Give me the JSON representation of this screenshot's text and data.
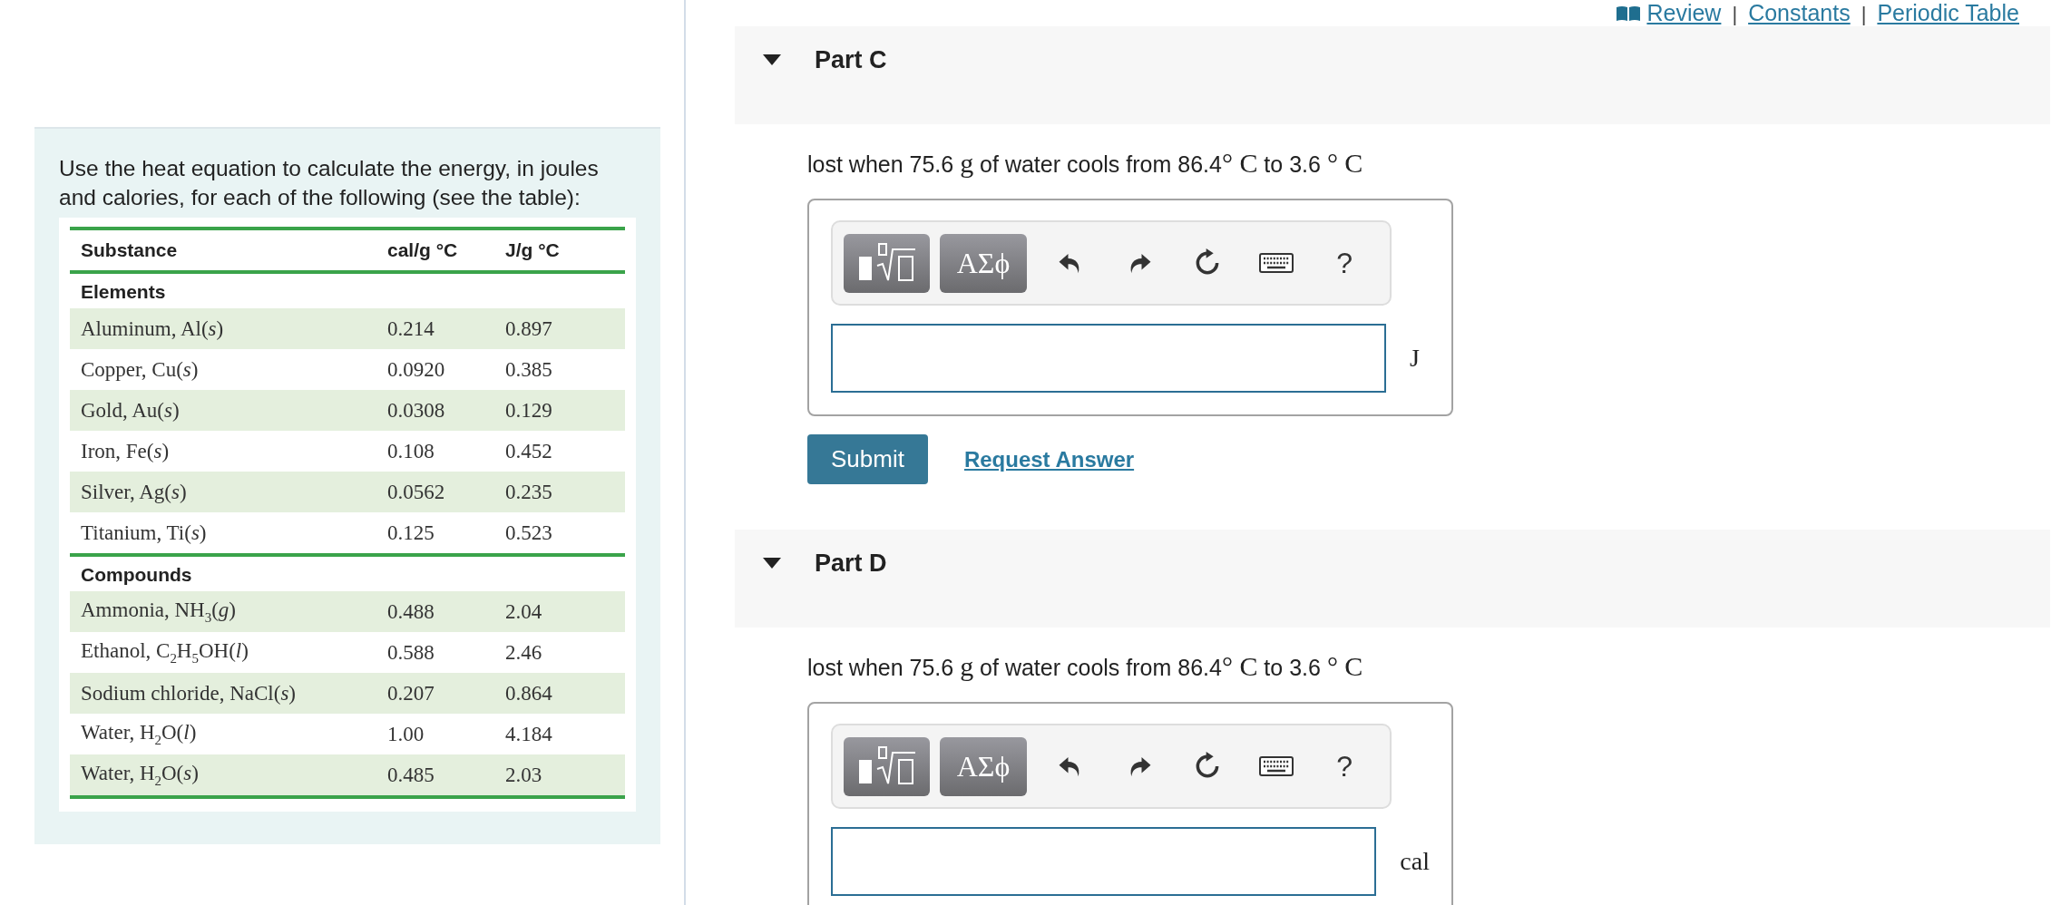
{
  "intro": "Use the heat equation to calculate the energy, in joules and calories, for each of the following (see the table):",
  "table": {
    "columns": [
      "Substance",
      "cal/g °C",
      "J/g °C"
    ],
    "rows": [
      {
        "kind": "section",
        "label": "Elements"
      },
      {
        "kind": "data",
        "cells": [
          "Aluminum, Al(*s*)",
          "0.214",
          "0.897"
        ]
      },
      {
        "kind": "data",
        "cells": [
          "Copper, Cu(*s*)",
          "0.0920",
          "0.385"
        ]
      },
      {
        "kind": "data",
        "cells": [
          "Gold, Au(*s*)",
          "0.0308",
          "0.129"
        ]
      },
      {
        "kind": "data",
        "cells": [
          "Iron, Fe(*s*)",
          "0.108",
          "0.452"
        ]
      },
      {
        "kind": "data",
        "cells": [
          "Silver, Ag(*s*)",
          "0.0562",
          "0.235"
        ]
      },
      {
        "kind": "data",
        "cells": [
          "Titanium, Ti(*s*)",
          "0.125",
          "0.523"
        ]
      },
      {
        "kind": "section",
        "label": "Compounds"
      },
      {
        "kind": "data",
        "cells": [
          "Ammonia, NH$_{3}$(*g*)",
          "0.488",
          "2.04"
        ]
      },
      {
        "kind": "data",
        "cells": [
          "Ethanol, C$_{2}$H$_{5}$OH(*l*)",
          "0.588",
          "2.46"
        ]
      },
      {
        "kind": "data",
        "cells": [
          "Sodium chloride, NaCl(*s*)",
          "0.207",
          "0.864"
        ]
      },
      {
        "kind": "data",
        "cells": [
          "Water, H$_{2}$O(*l*)",
          "1.00",
          "4.184"
        ]
      },
      {
        "kind": "data",
        "cells": [
          "Water, H$_{2}$O(*s*)",
          "0.485",
          "2.03"
        ]
      }
    ]
  },
  "links": [
    {
      "kind": "book-link",
      "label": "Review"
    },
    {
      "kind": "separator",
      "label": "|"
    },
    {
      "kind": "link",
      "label": "Constants"
    },
    {
      "kind": "separator",
      "label": "|"
    },
    {
      "kind": "link",
      "label": "Periodic Table"
    }
  ],
  "parts": [
    {
      "label": "Part C",
      "expanded": true,
      "problem": [
        {
          "kind": "text",
          "text": "lost when 75.6 "
        },
        {
          "kind": "math",
          "text": "g"
        },
        {
          "kind": "text",
          "text": " of water cools from 86.4"
        },
        {
          "kind": "math",
          "text": "° C"
        },
        {
          "kind": "text",
          "text": " to 3.6 "
        },
        {
          "kind": "math",
          "text": "° C"
        }
      ],
      "toolbar": {
        "symbols": "ΑΣϕ",
        "help": "?"
      },
      "unit": "J",
      "buttons": {
        "submit": "Submit",
        "request": "Request Answer"
      }
    },
    {
      "label": "Part D",
      "expanded": true,
      "problem": [
        {
          "kind": "text",
          "text": "lost when 75.6 "
        },
        {
          "kind": "math",
          "text": "g"
        },
        {
          "kind": "text",
          "text": " of water cools from 86.4"
        },
        {
          "kind": "math",
          "text": "° C"
        },
        {
          "kind": "text",
          "text": " to 3.6 "
        },
        {
          "kind": "math",
          "text": "° C"
        }
      ],
      "toolbar": {
        "symbols": "ΑΣϕ",
        "help": "?"
      },
      "unit": "cal"
    }
  ]
}
